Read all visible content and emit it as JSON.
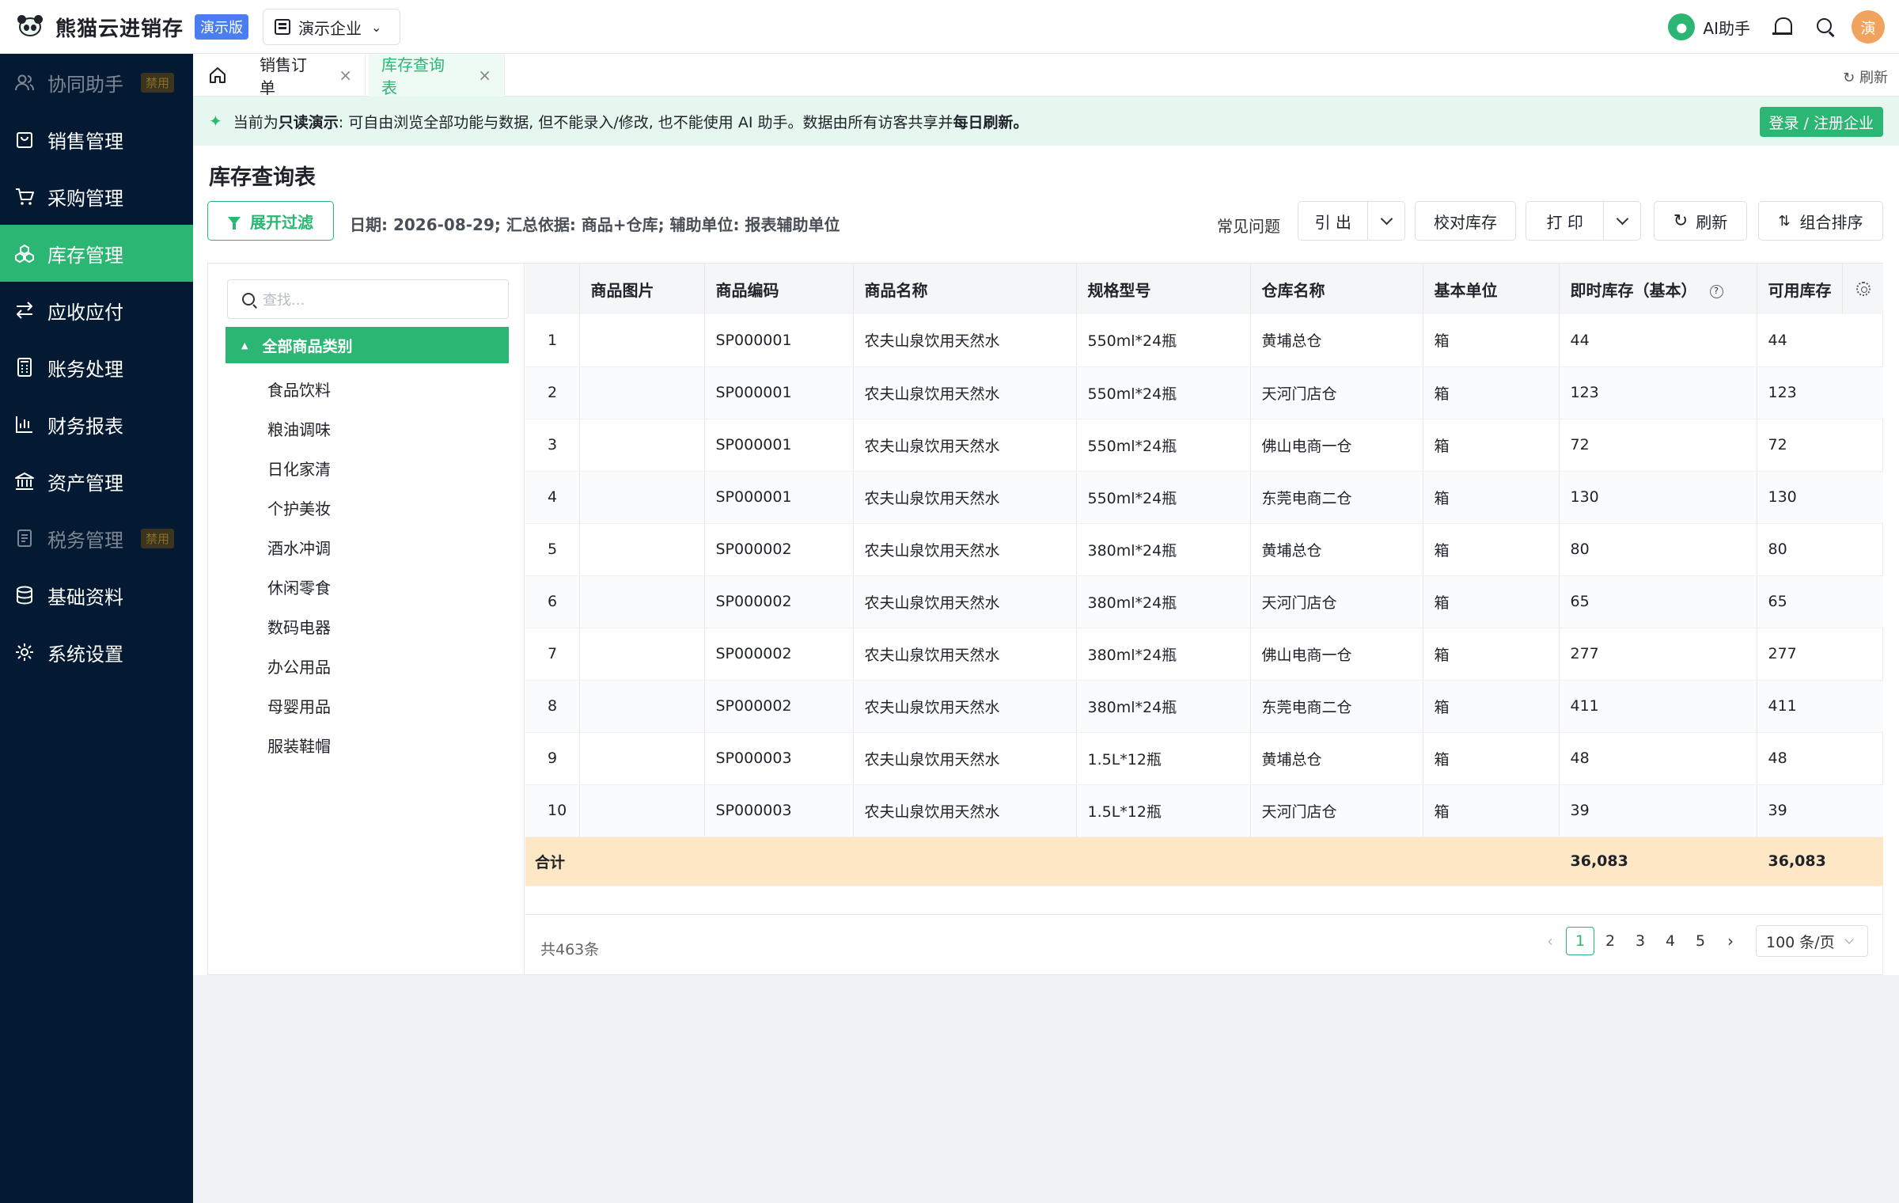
{
  "app": {
    "name": "熊猫云进销存",
    "edition_badge": "演示版",
    "company": "演示企业",
    "ai_label": "AI助手",
    "avatar_text": "演"
  },
  "sidebar": {
    "items": [
      {
        "label": "协同助手",
        "icon": "users-icon",
        "disabled": true,
        "tag": "禁用"
      },
      {
        "label": "销售管理",
        "icon": "shopping-bag-icon"
      },
      {
        "label": "采购管理",
        "icon": "cart-icon"
      },
      {
        "label": "库存管理",
        "icon": "cubes-icon",
        "active": true
      },
      {
        "label": "应收应付",
        "icon": "transfer-icon"
      },
      {
        "label": "账务处理",
        "icon": "calculator-icon"
      },
      {
        "label": "财务报表",
        "icon": "bar-chart-icon"
      },
      {
        "label": "资产管理",
        "icon": "bank-icon"
      },
      {
        "label": "税务管理",
        "icon": "document-icon",
        "disabled": true,
        "tag": "禁用"
      },
      {
        "label": "基础资料",
        "icon": "database-icon"
      },
      {
        "label": "系统设置",
        "icon": "gear-icon"
      }
    ]
  },
  "tabs": {
    "items": [
      {
        "label": "销售订单",
        "active": false
      },
      {
        "label": "库存查询表",
        "active": true
      }
    ],
    "refresh_label": "刷新"
  },
  "banner": {
    "prefix": "当前为",
    "mode": "只读演示",
    "middle": ": 可自由浏览全部功能与数据, 但不能录入/修改, 也不能使用 AI 助手。数据由所有访客共享并",
    "emphasis": "每日刷新。",
    "login_label": "登录 / 注册企业"
  },
  "page": {
    "title": "库存查询表",
    "filter_label": "展开过滤",
    "summary": "日期: 2026-08-29; 汇总依据: 商品+仓库; 辅助单位: 报表辅助单位",
    "faq_label": "常见问题",
    "export_label": "引 出",
    "check_label": "校对库存",
    "print_label": "打 印",
    "refresh_label": "刷新",
    "sort_label": "组合排序"
  },
  "tree": {
    "search_placeholder": "查找...",
    "root": "全部商品类别",
    "items": [
      "食品饮料",
      "粮油调味",
      "日化家清",
      "个护美妆",
      "酒水冲调",
      "休闲零食",
      "数码电器",
      "办公用品",
      "母婴用品",
      "服装鞋帽"
    ]
  },
  "table": {
    "headers": [
      "",
      "商品图片",
      "商品编码",
      "商品名称",
      "规格型号",
      "仓库名称",
      "基本单位",
      "即时库存（基本）",
      "可用库存"
    ],
    "rows": [
      [
        "1",
        "",
        "SP000001",
        "农夫山泉饮用天然水",
        "550ml*24瓶",
        "黄埔总仓",
        "箱",
        "44",
        "44"
      ],
      [
        "2",
        "",
        "SP000001",
        "农夫山泉饮用天然水",
        "550ml*24瓶",
        "天河门店仓",
        "箱",
        "123",
        "123"
      ],
      [
        "3",
        "",
        "SP000001",
        "农夫山泉饮用天然水",
        "550ml*24瓶",
        "佛山电商一仓",
        "箱",
        "72",
        "72"
      ],
      [
        "4",
        "",
        "SP000001",
        "农夫山泉饮用天然水",
        "550ml*24瓶",
        "东莞电商二仓",
        "箱",
        "130",
        "130"
      ],
      [
        "5",
        "",
        "SP000002",
        "农夫山泉饮用天然水",
        "380ml*24瓶",
        "黄埔总仓",
        "箱",
        "80",
        "80"
      ],
      [
        "6",
        "",
        "SP000002",
        "农夫山泉饮用天然水",
        "380ml*24瓶",
        "天河门店仓",
        "箱",
        "65",
        "65"
      ],
      [
        "7",
        "",
        "SP000002",
        "农夫山泉饮用天然水",
        "380ml*24瓶",
        "佛山电商一仓",
        "箱",
        "277",
        "277"
      ],
      [
        "8",
        "",
        "SP000002",
        "农夫山泉饮用天然水",
        "380ml*24瓶",
        "东莞电商二仓",
        "箱",
        "411",
        "411"
      ],
      [
        "9",
        "",
        "SP000003",
        "农夫山泉饮用天然水",
        "1.5L*12瓶",
        "黄埔总仓",
        "箱",
        "48",
        "48"
      ],
      [
        "10",
        "",
        "SP000003",
        "农夫山泉饮用天然水",
        "1.5L*12瓶",
        "天河门店仓",
        "箱",
        "39",
        "39"
      ]
    ],
    "total_label": "合计",
    "total_stock": "36,083",
    "total_available": "36,083"
  },
  "pagination": {
    "total_text": "共463条",
    "pages": [
      "1",
      "2",
      "3",
      "4",
      "5"
    ],
    "current": "1",
    "page_size": "100 条/页"
  },
  "colors": {
    "accent": "#2bb673",
    "sidebar_bg": "#041a32",
    "total_row_bg": "#fde7c5",
    "banner_bg": "#e6f7ef"
  }
}
